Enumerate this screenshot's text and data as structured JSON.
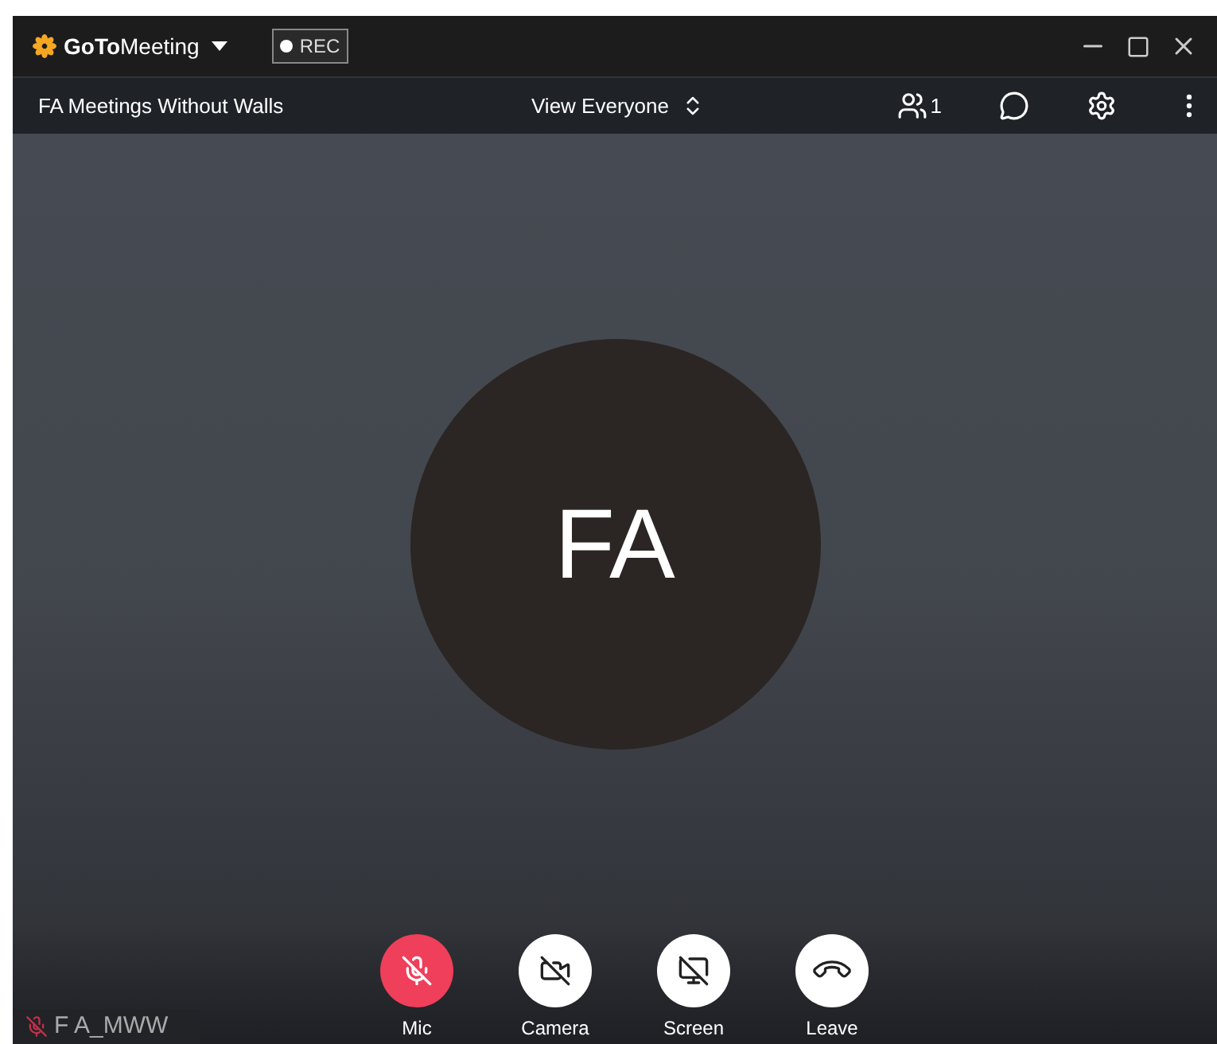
{
  "app": {
    "brand_bold": "GoTo",
    "brand_rest": "Meeting",
    "recording": "REC"
  },
  "meeting": {
    "title": "FA Meetings Without Walls",
    "view": "View Everyone",
    "participants": "1"
  },
  "stage": {
    "initials": "FA"
  },
  "controls": [
    {
      "kind": "mic",
      "label": "Mic",
      "alert": true
    },
    {
      "kind": "camera",
      "label": "Camera",
      "alert": false
    },
    {
      "kind": "screen",
      "label": "Screen",
      "alert": false
    },
    {
      "kind": "leave",
      "label": "Leave",
      "alert": false
    }
  ],
  "name_tag": {
    "name": "F A_MWW",
    "muted": true
  }
}
